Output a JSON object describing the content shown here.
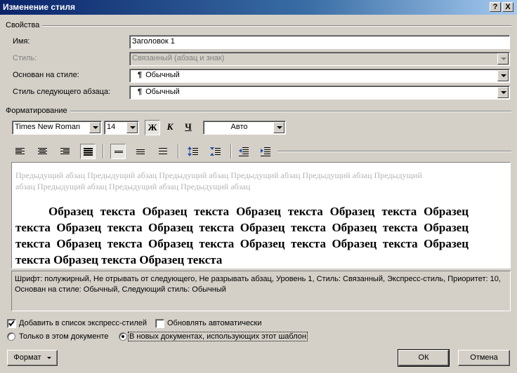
{
  "window": {
    "title": "Изменение стиля",
    "help_label": "?",
    "close_label": "X"
  },
  "properties": {
    "group_label": "Свойства",
    "name_label": "Имя:",
    "name_value": "Заголовок 1",
    "style_type_label": "Стиль:",
    "style_type_value": "Связанный (абзац и знак)",
    "based_on_label": "Основан на стиле:",
    "based_on_value": "Обычный",
    "next_style_label": "Стиль следующего абзаца:",
    "next_style_value": "Обычный",
    "paragraph_mark": "¶"
  },
  "formatting": {
    "group_label": "Форматирование",
    "font_name": "Times New Roman",
    "font_size": "14",
    "bold_label": "Ж",
    "italic_label": "К",
    "underline_label": "Ч",
    "color_value": "Авто"
  },
  "preview": {
    "previous_paragraph": "Предыдущий абзац Предыдущий абзац Предыдущий абзац Предыдущий абзац Предыдущий абзац Предыдущий абзац Предыдущий абзац Предыдущий абзац Предыдущий абзац",
    "sample_text": "Образец текста Образец текста Образец текста Образец текста Образец текста Образец текста Образец текста Образец текста Образец текста Образец текста Образец текста Образец текста Образец текста Образец текста Образец текста Образец текста Образец текста"
  },
  "description": "Шрифт: полужирный, Не отрывать от следующего, Не разрывать абзац, Уровень 1, Стиль: Связанный, Экспресс-стиль, Приоритет: 10, Основан на стиле: Обычный, Следующий стиль: Обычный",
  "options": {
    "add_to_quick_styles_label": "Добавить в список экспресс-стилей",
    "add_to_quick_styles_checked": true,
    "auto_update_label": "Обновлять автоматически",
    "auto_update_checked": false,
    "only_this_document_label": "Только в этом документе",
    "new_documents_label": "В новых документах, использующих этот шаблон",
    "selected_scope": "new_documents"
  },
  "buttons": {
    "format_label": "Формат",
    "ok_label": "ОК",
    "cancel_label": "Отмена"
  }
}
